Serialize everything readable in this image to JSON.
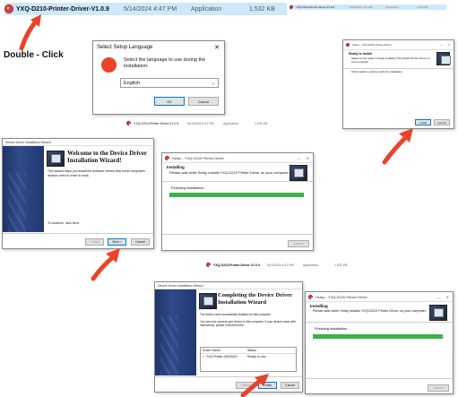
{
  "file_name": "YXQ-D210-Printer-Driver-V1.0.9",
  "file_date": "5/14/2024 4:47 PM",
  "file_type": "Application",
  "file_size": "1,532 KB",
  "double_click_label": "Double - Click",
  "lang_dialog": {
    "title": "Select Setup Language",
    "message": "Select the language to use during the installation:",
    "selected": "English",
    "ok": "OK",
    "cancel": "Cancel",
    "close": "✕"
  },
  "ready": {
    "title": "Setup - YXQ-D210-Printer-Driver",
    "heading": "Ready to Install",
    "sub": "Setup is now ready to begin installing YXQ-D210 Printer Driver on your computer.",
    "body": "Click Install to continue with the installation.",
    "install": "Install",
    "cancel": "Cancel"
  },
  "welcome": {
    "title": "Device Driver Installation Wizard",
    "heading": "Welcome to the Device Driver Installation Wizard!",
    "body": "This wizard helps you install the software drivers that some computers devices need in order to work.",
    "cont": "To continue, click Next.",
    "back": "< Back",
    "next": "Next >",
    "cancel": "Cancel"
  },
  "installing": {
    "title": "Setup - YXQ-D210 Printer Driver",
    "heading": "Installing",
    "sub": "Please wait while Setup installs YXQ-D210 Printer Driver on your computer.",
    "status": "Finishing installation...",
    "cancel": "Cancel",
    "progress": 1.0
  },
  "complete": {
    "title": "Device Driver Installation Wizard",
    "heading": "Completing the Device Driver Installation Wizard",
    "body1": "The drivers were successfully installed on this computer.",
    "body2": "You can now connect your device to this computer. If your device came with instructions, please read them first.",
    "col1": "Driver Name",
    "col2": "Status",
    "row_name": "✓ YXQ Printer (09/15/20...",
    "row_status": "Ready to use",
    "back": "< Back",
    "finish": "Finish",
    "cancel": "Cancel"
  },
  "colors": {
    "accent": "#e8442a",
    "progress": "#3cb24a"
  }
}
